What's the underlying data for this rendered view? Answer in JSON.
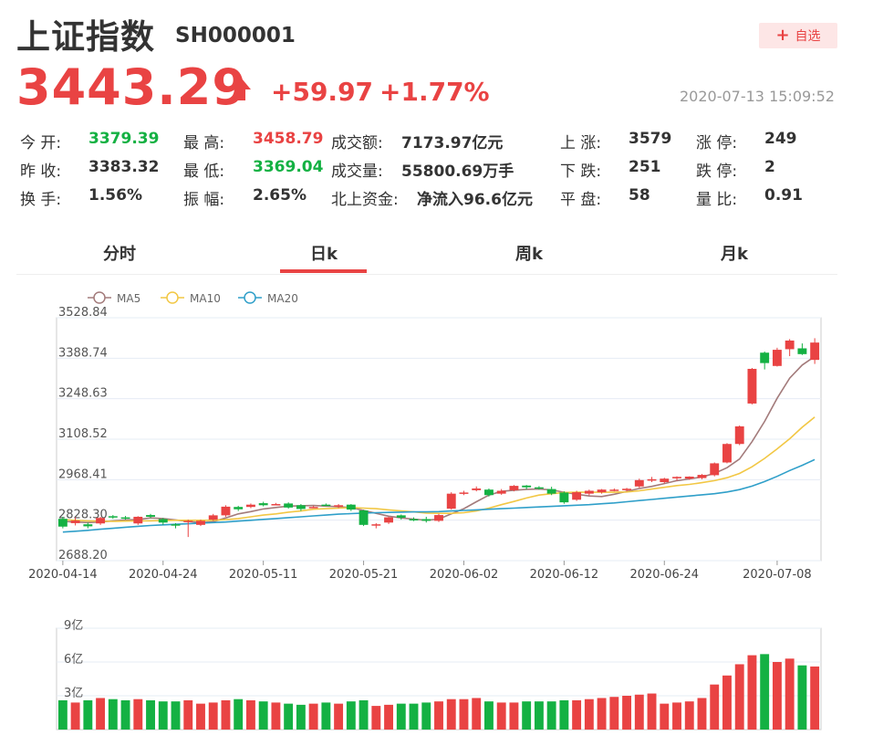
{
  "header": {
    "name": "上证指数",
    "code": "SH000001",
    "watch_label": "自选",
    "price": "3443.29",
    "change": "+59.97",
    "change_pct": "+1.77%",
    "time": "2020-07-13 15:09:52"
  },
  "quote": {
    "open_label": "今    开:",
    "open": "3379.39",
    "prev_close_label": "昨    收:",
    "prev_close": "3383.32",
    "turnover_label": "换    手:",
    "turnover": "1.56%",
    "high_label": "最    高:",
    "high": "3458.79",
    "low_label": "最    低:",
    "low": "3369.04",
    "amplitude_label": "振    幅:",
    "amplitude": "2.65%",
    "amount_label": "成交额:",
    "amount": "7173.97亿元",
    "volume_label": "成交量:",
    "volume": "55800.69万手",
    "northbound_label": "北上资金:",
    "northbound": "净流入96.6亿元",
    "up_label": "上    涨:",
    "up": "3579",
    "down_label": "下    跌:",
    "down": "251",
    "flat_label": "平    盘:",
    "flat": "58",
    "limit_up_label": "涨    停:",
    "limit_up": "249",
    "limit_down_label": "跌    停:",
    "limit_down": "2",
    "vol_ratio_label": "量    比:",
    "vol_ratio": "0.91"
  },
  "tabs": [
    {
      "label": "分时",
      "active": false
    },
    {
      "label": "日k",
      "active": true
    },
    {
      "label": "周k",
      "active": false
    },
    {
      "label": "月k",
      "active": false
    }
  ],
  "colors": {
    "up": "#e94343",
    "down": "#14b143",
    "ma5": "#a37b7b",
    "ma10": "#f2c744",
    "ma20": "#2f9fc9"
  },
  "chart_data": {
    "type": "candlestick",
    "legend": [
      "MA5",
      "MA10",
      "MA20"
    ],
    "y_ticks": [
      "3528.84",
      "3388.74",
      "3248.63",
      "3108.52",
      "2968.41",
      "2828.30",
      "2688.20"
    ],
    "ylim": [
      2688.2,
      3528.84
    ],
    "x_ticks": [
      "2020-04-14",
      "2020-04-24",
      "2020-05-11",
      "2020-05-21",
      "2020-06-02",
      "2020-06-12",
      "2020-06-24",
      "2020-07-08"
    ],
    "x_tick_index": [
      0,
      8,
      16,
      24,
      32,
      40,
      48,
      57
    ],
    "candles": [
      [
        2833,
        2806,
        2840,
        2800
      ],
      [
        2818,
        2827,
        2838,
        2810
      ],
      [
        2814,
        2807,
        2820,
        2800
      ],
      [
        2817,
        2836,
        2840,
        2812
      ],
      [
        2842,
        2838,
        2846,
        2833
      ],
      [
        2838,
        2835,
        2843,
        2830
      ],
      [
        2817,
        2840,
        2842,
        2812
      ],
      [
        2846,
        2840,
        2850,
        2836
      ],
      [
        2832,
        2820,
        2836,
        2812
      ],
      [
        2814,
        2812,
        2818,
        2800
      ],
      [
        2826,
        2826,
        2830,
        2770
      ],
      [
        2812,
        2826,
        2830,
        2808
      ],
      [
        2830,
        2845,
        2850,
        2826
      ],
      [
        2845,
        2875,
        2880,
        2840
      ],
      [
        2874,
        2866,
        2878,
        2860
      ],
      [
        2874,
        2882,
        2886,
        2870
      ],
      [
        2887,
        2880,
        2892,
        2876
      ],
      [
        2884,
        2884,
        2888,
        2880
      ],
      [
        2886,
        2872,
        2890,
        2868
      ],
      [
        2880,
        2867,
        2884,
        2860
      ],
      [
        2874,
        2874,
        2878,
        2870
      ],
      [
        2882,
        2880,
        2886,
        2878
      ],
      [
        2875,
        2880,
        2884,
        2870
      ],
      [
        2882,
        2865,
        2884,
        2860
      ],
      [
        2862,
        2812,
        2864,
        2808
      ],
      [
        2812,
        2814,
        2818,
        2800
      ],
      [
        2820,
        2838,
        2840,
        2815
      ],
      [
        2845,
        2837,
        2848,
        2830
      ],
      [
        2832,
        2828,
        2838,
        2825
      ],
      [
        2832,
        2826,
        2840,
        2820
      ],
      [
        2826,
        2846,
        2850,
        2822
      ],
      [
        2868,
        2920,
        2925,
        2865
      ],
      [
        2920,
        2924,
        2930,
        2915
      ],
      [
        2932,
        2938,
        2945,
        2928
      ],
      [
        2934,
        2915,
        2938,
        2910
      ],
      [
        2920,
        2930,
        2936,
        2916
      ],
      [
        2932,
        2947,
        2950,
        2928
      ],
      [
        2948,
        2942,
        2950,
        2935
      ],
      [
        2942,
        2940,
        2946,
        2934
      ],
      [
        2936,
        2920,
        2944,
        2915
      ],
      [
        2924,
        2890,
        2928,
        2885
      ],
      [
        2899,
        2925,
        2930,
        2895
      ],
      [
        2920,
        2930,
        2934,
        2914
      ],
      [
        2925,
        2934,
        2936,
        2920
      ],
      [
        2934,
        2934,
        2938,
        2928
      ],
      [
        2932,
        2937,
        2940,
        2928
      ],
      [
        2945,
        2967,
        2972,
        2940
      ],
      [
        2965,
        2970,
        2978,
        2960
      ],
      [
        2960,
        2972,
        2975,
        2955
      ],
      [
        2973,
        2978,
        2980,
        2965
      ],
      [
        2972,
        2979,
        2980,
        2968
      ],
      [
        2974,
        2985,
        2988,
        2970
      ],
      [
        2984,
        3025,
        3028,
        2980
      ],
      [
        3028,
        3092,
        3095,
        3025
      ],
      [
        3092,
        3153,
        3156,
        3088
      ],
      [
        3232,
        3352,
        3355,
        3229
      ],
      [
        3408,
        3372,
        3412,
        3350
      ],
      [
        3362,
        3418,
        3425,
        3360
      ],
      [
        3420,
        3450,
        3455,
        3396
      ],
      [
        3423,
        3403,
        3440,
        3400
      ],
      [
        3383,
        3443,
        3458,
        3369
      ]
    ],
    "ma5": [
      2824,
      2822,
      2820,
      2822,
      2826,
      2829,
      2830,
      2836,
      2834,
      2829,
      2824,
      2820,
      2823,
      2836,
      2850,
      2858,
      2867,
      2872,
      2877,
      2878,
      2879,
      2877,
      2875,
      2872,
      2862,
      2852,
      2842,
      2836,
      2832,
      2828,
      2832,
      2850,
      2868,
      2892,
      2915,
      2928,
      2932,
      2935,
      2936,
      2933,
      2925,
      2918,
      2912,
      2910,
      2918,
      2928,
      2938,
      2945,
      2955,
      2965,
      2971,
      2978,
      2990,
      3010,
      3040,
      3100,
      3170,
      3250,
      3320,
      3365,
      3395
    ],
    "ma10": [
      2830,
      2828,
      2826,
      2825,
      2824,
      2825,
      2826,
      2826,
      2827,
      2828,
      2828,
      2828,
      2828,
      2830,
      2834,
      2840,
      2846,
      2850,
      2856,
      2860,
      2866,
      2868,
      2870,
      2872,
      2870,
      2868,
      2864,
      2860,
      2857,
      2853,
      2852,
      2852,
      2854,
      2860,
      2870,
      2882,
      2893,
      2905,
      2915,
      2920,
      2924,
      2925,
      2925,
      2925,
      2925,
      2926,
      2930,
      2936,
      2942,
      2948,
      2952,
      2958,
      2965,
      2975,
      2990,
      3013,
      3042,
      3075,
      3110,
      3150,
      3185
    ],
    "ma20": [
      2787,
      2790,
      2793,
      2797,
      2800,
      2804,
      2807,
      2810,
      2812,
      2814,
      2816,
      2818,
      2820,
      2822,
      2825,
      2828,
      2831,
      2834,
      2837,
      2840,
      2843,
      2846,
      2849,
      2851,
      2853,
      2854,
      2855,
      2856,
      2857,
      2857,
      2858,
      2860,
      2862,
      2864,
      2866,
      2868,
      2870,
      2872,
      2874,
      2876,
      2878,
      2880,
      2882,
      2885,
      2888,
      2892,
      2896,
      2900,
      2904,
      2908,
      2912,
      2916,
      2920,
      2926,
      2934,
      2946,
      2962,
      2980,
      3000,
      3018,
      3038
    ],
    "volume_ticks": [
      "9亿",
      "6亿",
      "3亿"
    ],
    "volume_max": 9,
    "volume": [
      2.6,
      2.4,
      2.6,
      2.8,
      2.7,
      2.6,
      2.7,
      2.6,
      2.5,
      2.5,
      2.6,
      2.3,
      2.4,
      2.6,
      2.7,
      2.6,
      2.5,
      2.4,
      2.3,
      2.2,
      2.3,
      2.4,
      2.3,
      2.5,
      2.6,
      2.1,
      2.2,
      2.3,
      2.3,
      2.4,
      2.5,
      2.7,
      2.7,
      2.8,
      2.5,
      2.4,
      2.4,
      2.5,
      2.5,
      2.5,
      2.6,
      2.6,
      2.7,
      2.8,
      2.9,
      3.0,
      3.1,
      3.2,
      2.3,
      2.4,
      2.5,
      2.8,
      4.0,
      4.8,
      5.8,
      6.6,
      6.7,
      6.0,
      6.3,
      5.7,
      5.6
    ]
  }
}
